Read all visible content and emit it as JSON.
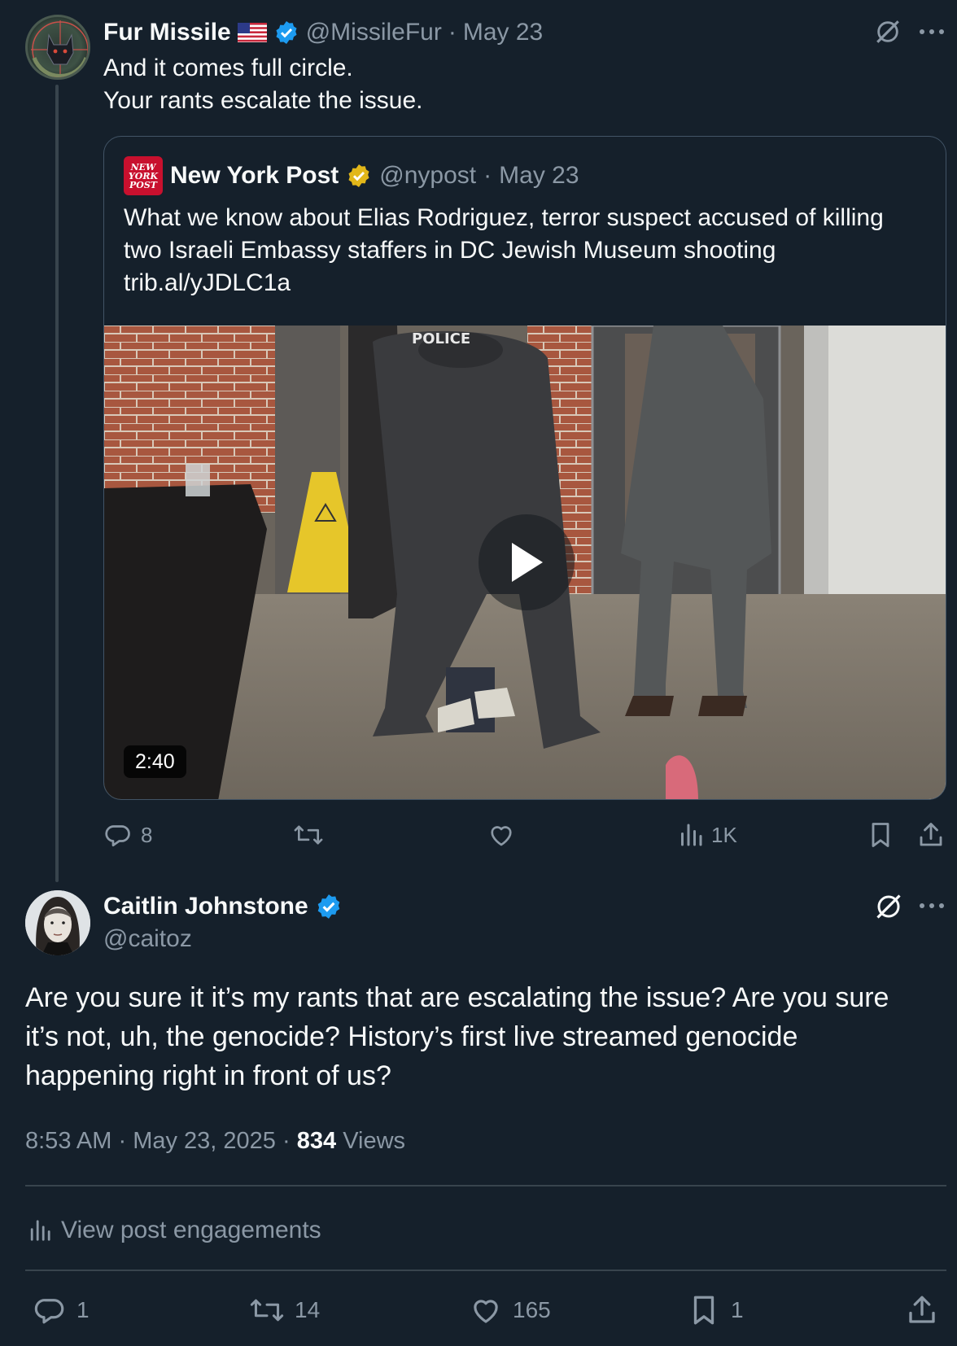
{
  "reply_context": {
    "author_name": "Fur Missile",
    "handle": "@MissileFur",
    "date": "May 23",
    "separator": "·",
    "text_lines": [
      "And it comes full circle.",
      "Your rants escalate the issue."
    ],
    "avatar_text": "MALINATOR"
  },
  "quoted_post": {
    "author_name": "New York Post",
    "handle": "@nypost",
    "date": "May 23",
    "logo_text": "NEW YORK POST",
    "text_lines": [
      "What we know about Elias Rodriguez, terror suspect accused of killing",
      "two Israeli Embassy staffers in DC Jewish Museum shooting",
      "trib.al/yJDLC1a"
    ],
    "video_duration": "2:40",
    "video_sign_text": "POLICE"
  },
  "reply_actions": {
    "replies": "8",
    "retweets": "",
    "likes": "",
    "views": "1K"
  },
  "main_post": {
    "author_name": "Caitlin Johnstone",
    "handle": "@caitoz",
    "text_lines": [
      "Are you sure it it’s my rants that are escalating the issue? Are you sure",
      "it’s not, uh, the genocide? History’s first live streamed genocide",
      "happening right in front of us?"
    ],
    "time": "8:53 AM",
    "date": "May 23, 2025",
    "views_count": "834",
    "views_label": "Views",
    "separator": "·",
    "engagements_label": "View post engagements"
  },
  "main_actions": {
    "replies": "1",
    "retweets": "14",
    "likes": "165",
    "bookmarks": "1"
  },
  "colors": {
    "background": "#15202b",
    "text": "#f7f9f9",
    "muted": "#8b98a5",
    "verified_blue": "#1d9bf0",
    "verified_gold": "#e2b719",
    "divider": "#38444d",
    "nypost_red": "#c8102e"
  },
  "icons": [
    "grok-icon",
    "more-icon",
    "verified-badge-icon",
    "us-flag-icon",
    "reply-icon",
    "retweet-icon",
    "like-icon",
    "views-icon",
    "bookmark-icon",
    "share-icon",
    "play-icon"
  ]
}
